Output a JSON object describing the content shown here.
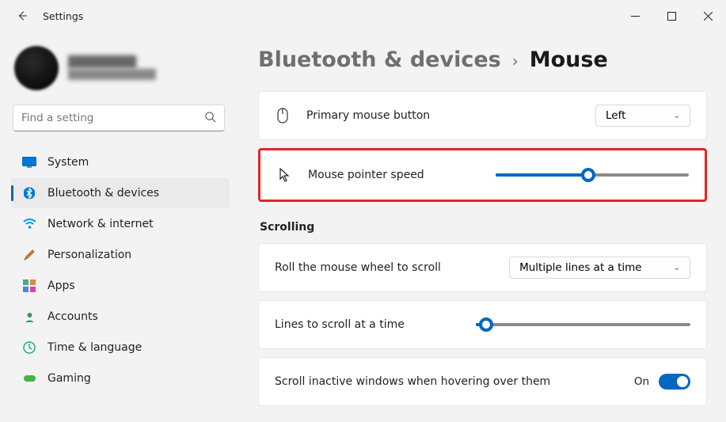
{
  "window": {
    "title": "Settings"
  },
  "profile": {
    "name": "████████",
    "email": "████████████"
  },
  "search": {
    "placeholder": "Find a setting"
  },
  "sidebar": {
    "items": [
      {
        "label": "System"
      },
      {
        "label": "Bluetooth & devices"
      },
      {
        "label": "Network & internet"
      },
      {
        "label": "Personalization"
      },
      {
        "label": "Apps"
      },
      {
        "label": "Accounts"
      },
      {
        "label": "Time & language"
      },
      {
        "label": "Gaming"
      }
    ]
  },
  "breadcrumb": {
    "parent": "Bluetooth & devices",
    "current": "Mouse"
  },
  "primary_mouse": {
    "label": "Primary mouse button",
    "value": "Left"
  },
  "pointer_speed": {
    "label": "Mouse pointer speed",
    "percent": 48
  },
  "scrolling": {
    "title": "Scrolling",
    "wheel": {
      "label": "Roll the mouse wheel to scroll",
      "value": "Multiple lines at a time"
    },
    "lines": {
      "label": "Lines to scroll at a time",
      "percent": 5
    },
    "inactive": {
      "label": "Scroll inactive windows when hovering over them",
      "state": "On"
    }
  }
}
